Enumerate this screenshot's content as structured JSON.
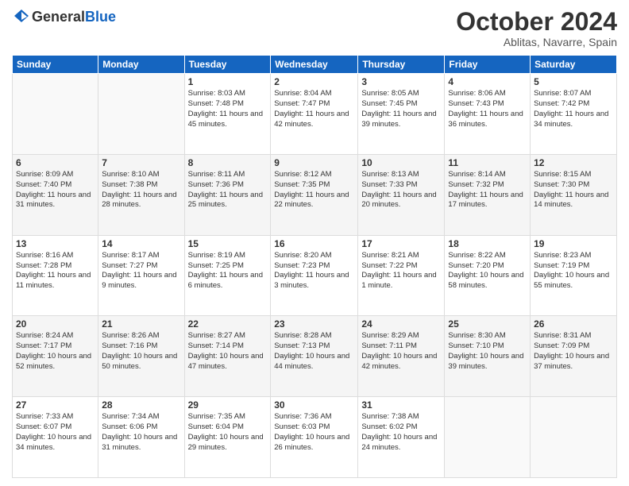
{
  "header": {
    "logo": {
      "general": "General",
      "blue": "Blue"
    },
    "month": "October 2024",
    "location": "Ablitas, Navarre, Spain"
  },
  "weekdays": [
    "Sunday",
    "Monday",
    "Tuesday",
    "Wednesday",
    "Thursday",
    "Friday",
    "Saturday"
  ],
  "weeks": [
    [
      {
        "day": "",
        "detail": ""
      },
      {
        "day": "",
        "detail": ""
      },
      {
        "day": "1",
        "detail": "Sunrise: 8:03 AM\nSunset: 7:48 PM\nDaylight: 11 hours and 45 minutes."
      },
      {
        "day": "2",
        "detail": "Sunrise: 8:04 AM\nSunset: 7:47 PM\nDaylight: 11 hours and 42 minutes."
      },
      {
        "day": "3",
        "detail": "Sunrise: 8:05 AM\nSunset: 7:45 PM\nDaylight: 11 hours and 39 minutes."
      },
      {
        "day": "4",
        "detail": "Sunrise: 8:06 AM\nSunset: 7:43 PM\nDaylight: 11 hours and 36 minutes."
      },
      {
        "day": "5",
        "detail": "Sunrise: 8:07 AM\nSunset: 7:42 PM\nDaylight: 11 hours and 34 minutes."
      }
    ],
    [
      {
        "day": "6",
        "detail": "Sunrise: 8:09 AM\nSunset: 7:40 PM\nDaylight: 11 hours and 31 minutes."
      },
      {
        "day": "7",
        "detail": "Sunrise: 8:10 AM\nSunset: 7:38 PM\nDaylight: 11 hours and 28 minutes."
      },
      {
        "day": "8",
        "detail": "Sunrise: 8:11 AM\nSunset: 7:36 PM\nDaylight: 11 hours and 25 minutes."
      },
      {
        "day": "9",
        "detail": "Sunrise: 8:12 AM\nSunset: 7:35 PM\nDaylight: 11 hours and 22 minutes."
      },
      {
        "day": "10",
        "detail": "Sunrise: 8:13 AM\nSunset: 7:33 PM\nDaylight: 11 hours and 20 minutes."
      },
      {
        "day": "11",
        "detail": "Sunrise: 8:14 AM\nSunset: 7:32 PM\nDaylight: 11 hours and 17 minutes."
      },
      {
        "day": "12",
        "detail": "Sunrise: 8:15 AM\nSunset: 7:30 PM\nDaylight: 11 hours and 14 minutes."
      }
    ],
    [
      {
        "day": "13",
        "detail": "Sunrise: 8:16 AM\nSunset: 7:28 PM\nDaylight: 11 hours and 11 minutes."
      },
      {
        "day": "14",
        "detail": "Sunrise: 8:17 AM\nSunset: 7:27 PM\nDaylight: 11 hours and 9 minutes."
      },
      {
        "day": "15",
        "detail": "Sunrise: 8:19 AM\nSunset: 7:25 PM\nDaylight: 11 hours and 6 minutes."
      },
      {
        "day": "16",
        "detail": "Sunrise: 8:20 AM\nSunset: 7:23 PM\nDaylight: 11 hours and 3 minutes."
      },
      {
        "day": "17",
        "detail": "Sunrise: 8:21 AM\nSunset: 7:22 PM\nDaylight: 11 hours and 1 minute."
      },
      {
        "day": "18",
        "detail": "Sunrise: 8:22 AM\nSunset: 7:20 PM\nDaylight: 10 hours and 58 minutes."
      },
      {
        "day": "19",
        "detail": "Sunrise: 8:23 AM\nSunset: 7:19 PM\nDaylight: 10 hours and 55 minutes."
      }
    ],
    [
      {
        "day": "20",
        "detail": "Sunrise: 8:24 AM\nSunset: 7:17 PM\nDaylight: 10 hours and 52 minutes."
      },
      {
        "day": "21",
        "detail": "Sunrise: 8:26 AM\nSunset: 7:16 PM\nDaylight: 10 hours and 50 minutes."
      },
      {
        "day": "22",
        "detail": "Sunrise: 8:27 AM\nSunset: 7:14 PM\nDaylight: 10 hours and 47 minutes."
      },
      {
        "day": "23",
        "detail": "Sunrise: 8:28 AM\nSunset: 7:13 PM\nDaylight: 10 hours and 44 minutes."
      },
      {
        "day": "24",
        "detail": "Sunrise: 8:29 AM\nSunset: 7:11 PM\nDaylight: 10 hours and 42 minutes."
      },
      {
        "day": "25",
        "detail": "Sunrise: 8:30 AM\nSunset: 7:10 PM\nDaylight: 10 hours and 39 minutes."
      },
      {
        "day": "26",
        "detail": "Sunrise: 8:31 AM\nSunset: 7:09 PM\nDaylight: 10 hours and 37 minutes."
      }
    ],
    [
      {
        "day": "27",
        "detail": "Sunrise: 7:33 AM\nSunset: 6:07 PM\nDaylight: 10 hours and 34 minutes."
      },
      {
        "day": "28",
        "detail": "Sunrise: 7:34 AM\nSunset: 6:06 PM\nDaylight: 10 hours and 31 minutes."
      },
      {
        "day": "29",
        "detail": "Sunrise: 7:35 AM\nSunset: 6:04 PM\nDaylight: 10 hours and 29 minutes."
      },
      {
        "day": "30",
        "detail": "Sunrise: 7:36 AM\nSunset: 6:03 PM\nDaylight: 10 hours and 26 minutes."
      },
      {
        "day": "31",
        "detail": "Sunrise: 7:38 AM\nSunset: 6:02 PM\nDaylight: 10 hours and 24 minutes."
      },
      {
        "day": "",
        "detail": ""
      },
      {
        "day": "",
        "detail": ""
      }
    ]
  ]
}
